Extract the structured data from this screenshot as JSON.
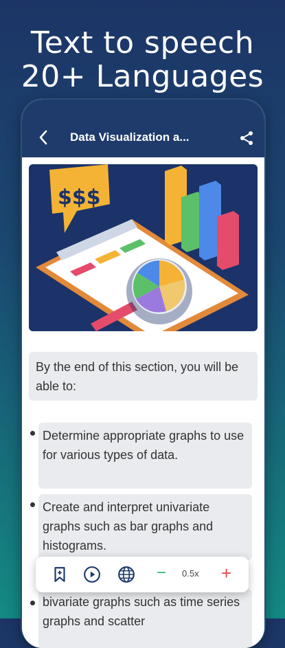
{
  "headline": {
    "line1": "Text to speech",
    "line2": "20+ Languages"
  },
  "appbar": {
    "title": "Data Visualization a..."
  },
  "hero": {
    "money_text": "$$$"
  },
  "intro": {
    "text": "By the end of this section, you will be able to:"
  },
  "bullets": [
    {
      "text": "Determine appropriate graphs to use for various types of data."
    },
    {
      "text": "Create and interpret univariate graphs such as bar graphs and histograms."
    },
    {
      "text": "bivariate graphs such as time series graphs and scatter"
    }
  ],
  "player": {
    "speed_label": "0.5x",
    "minus_label": "−",
    "plus_label": "+",
    "icons": [
      "bookmark-icon",
      "play-icon",
      "globe-icon"
    ]
  },
  "colors": {
    "appbar": "#1f3b6b",
    "accent_green": "#2bb673",
    "accent_red": "#e64a4a"
  }
}
